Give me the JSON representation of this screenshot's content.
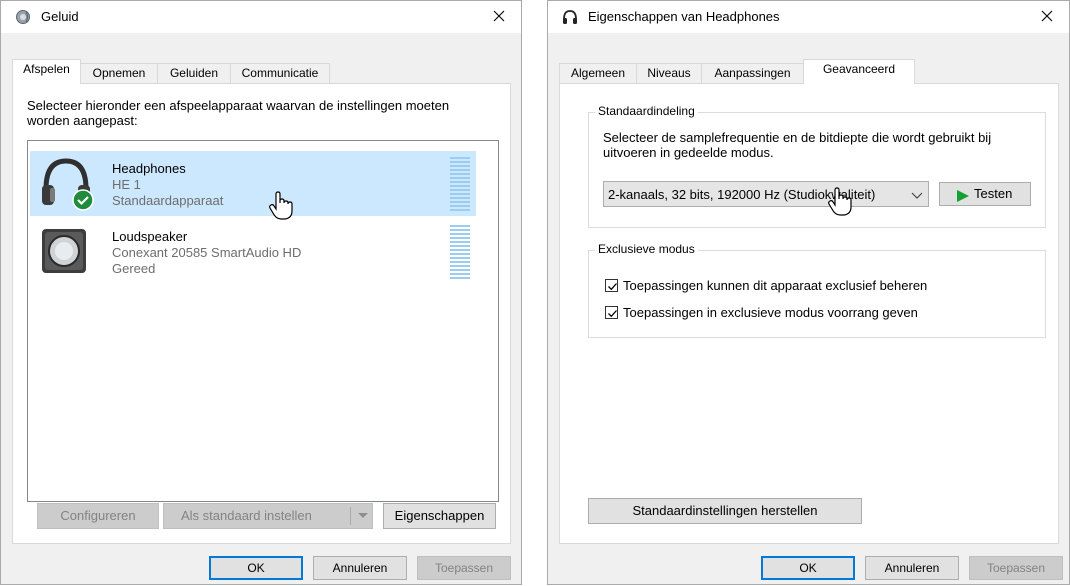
{
  "left_dialog": {
    "title": "Geluid",
    "tabs": [
      "Afspelen",
      "Opnemen",
      "Geluiden",
      "Communicatie"
    ],
    "active_tab": "Afspelen",
    "instruction": "Selecteer hieronder een afspeelapparaat waarvan de instellingen moeten worden aangepast:",
    "devices": [
      {
        "name": "Headphones",
        "line2": "HE 1",
        "line3": "Standaardapparaat",
        "icon": "headphones-icon",
        "selected": true,
        "default_badge": "checkmark-icon"
      },
      {
        "name": "Loudspeaker",
        "line2": "Conexant 20585 SmartAudio HD",
        "line3": "Gereed",
        "icon": "speaker-icon",
        "selected": false
      }
    ],
    "buttons": {
      "configure": "Configureren",
      "set_default": "Als standaard instellen",
      "properties": "Eigenschappen",
      "ok": "OK",
      "cancel": "Annuleren",
      "apply": "Toepassen"
    }
  },
  "right_dialog": {
    "title": "Eigenschappen van Headphones",
    "tabs": [
      "Algemeen",
      "Niveaus",
      "Aanpassingen",
      "Geavanceerd"
    ],
    "active_tab": "Geavanceerd",
    "default_format": {
      "legend": "Standaardindeling",
      "description": "Selecteer de samplefrequentie en de bitdiepte die wordt gebruikt bij uitvoeren in gedeelde modus.",
      "selected_format": "2-kanaals, 32 bits, 192000 Hz (Studiokwaliteit)",
      "test_button": "Testen"
    },
    "exclusive_mode": {
      "legend": "Exclusieve modus",
      "options": [
        {
          "label": "Toepassingen kunnen dit apparaat exclusief beheren",
          "checked": true
        },
        {
          "label": "Toepassingen in exclusieve modus voorrang geven",
          "checked": true
        }
      ]
    },
    "buttons": {
      "restore_defaults": "Standaardinstellingen herstellen",
      "ok": "OK",
      "cancel": "Annuleren",
      "apply": "Toepassen"
    }
  },
  "colors": {
    "selection": "#cce8ff",
    "accent": "#0078d7",
    "green_check": "#1e8c3a",
    "test_triangle": "#15a032",
    "disabled_text": "#838383"
  }
}
